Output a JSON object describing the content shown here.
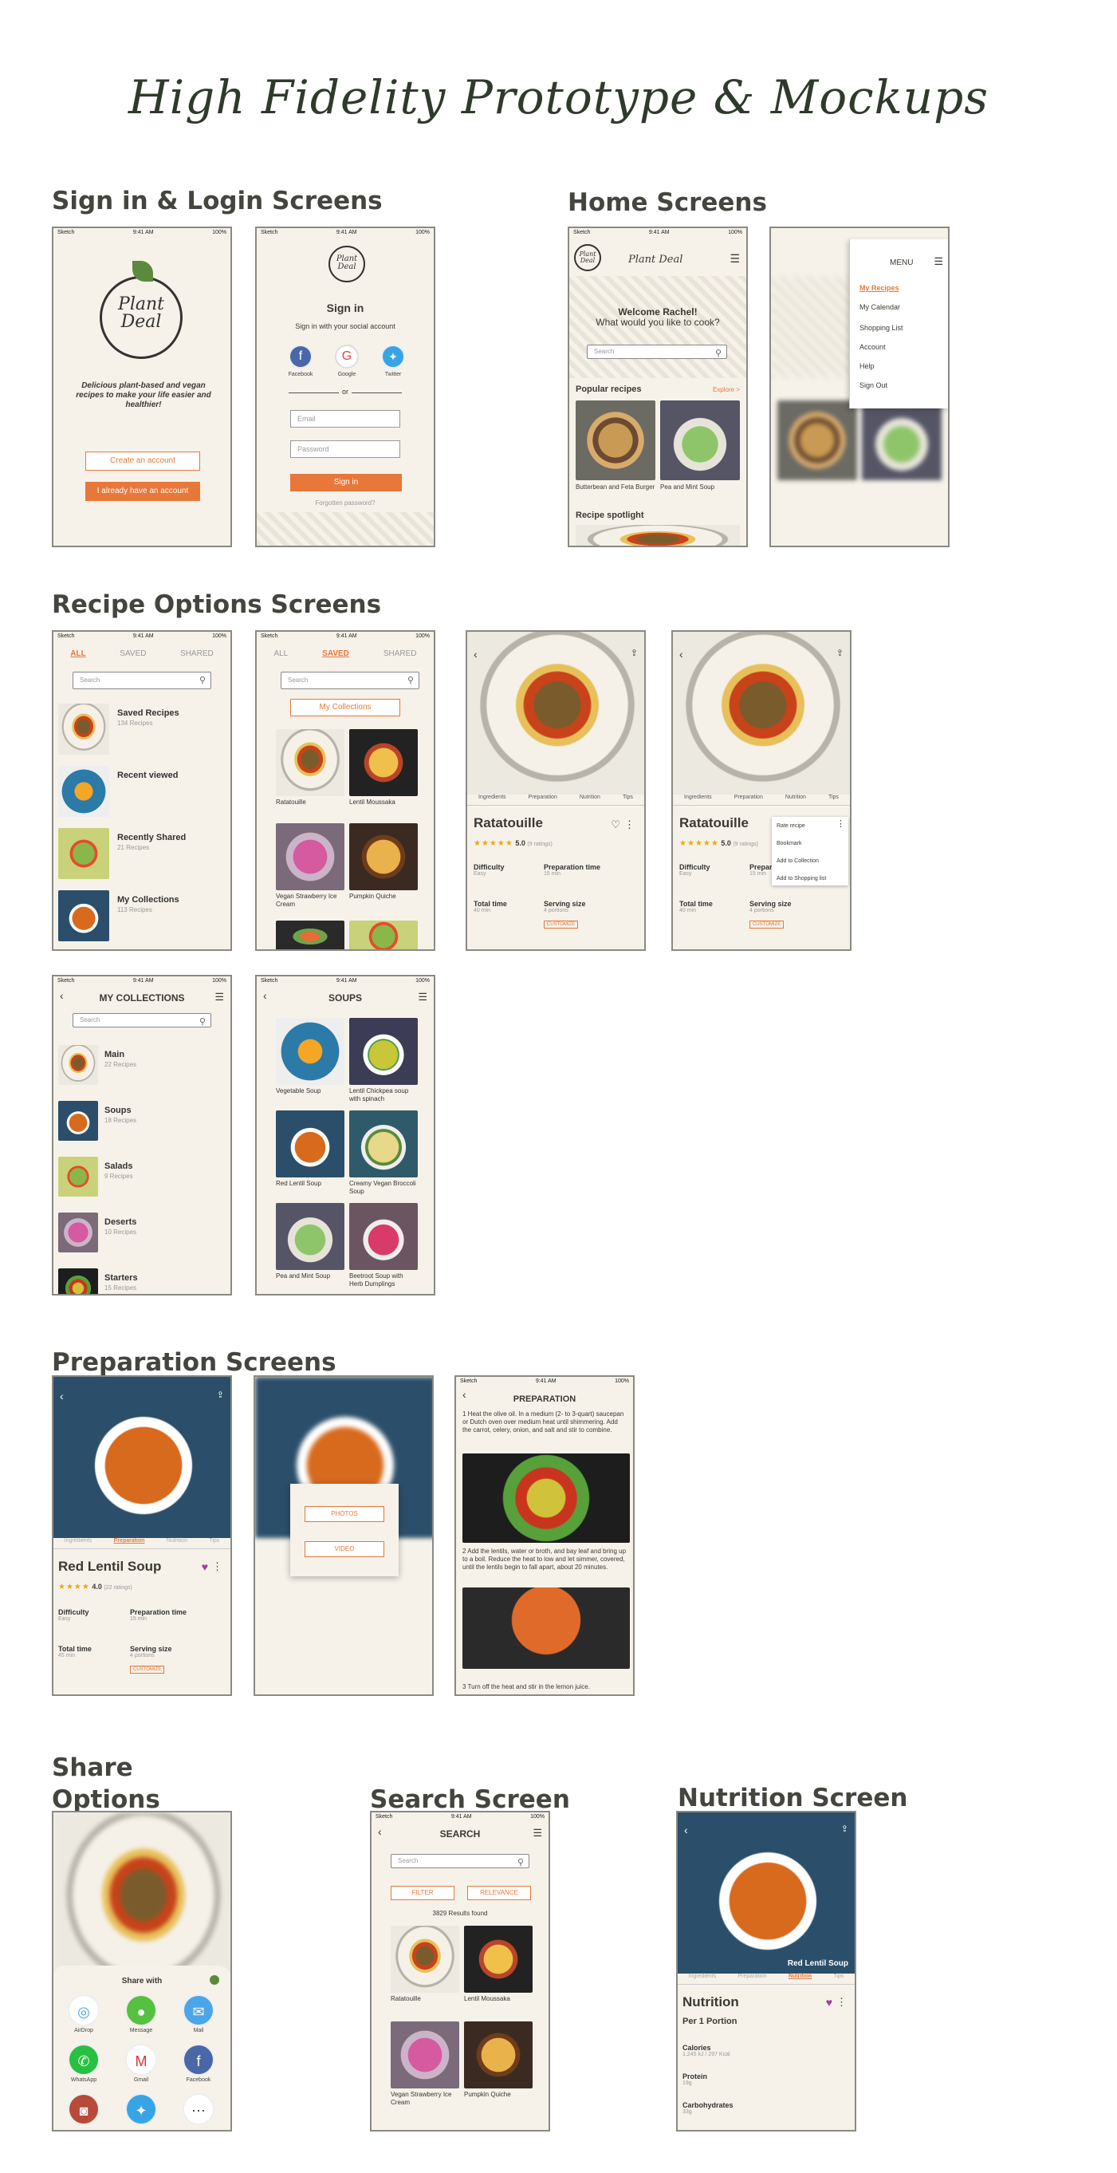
{
  "page_title": "High Fidelity Prototype & Mockups",
  "sections": {
    "signin": "Sign in & Login Screens",
    "home": "Home Screens",
    "recipe": "Recipe Options Screens",
    "prep": "Preparation Screens",
    "share": "Share Options Screen",
    "search": "Search Screen",
    "nutrition": "Nutrition Screen"
  },
  "status": {
    "carrier": "Sketch",
    "time": "9:41 AM",
    "battery": "100%"
  },
  "splash": {
    "logo_line1": "Plant",
    "logo_line2": "Deal",
    "tagline": "Delicious plant-based and vegan recipes to make your life easier and healthier!",
    "create": "Create an account",
    "have": "I already have an account"
  },
  "signin": {
    "title": "Sign in",
    "subtitle": "Sign in with your social account",
    "facebook": "Facebook",
    "google": "Google",
    "twitter": "Twitter",
    "or": "or",
    "email": "Email",
    "password": "Password",
    "button": "Sign in",
    "forgot": "Forgotten password?"
  },
  "home": {
    "brand": "Plant Deal",
    "welcome": "Welcome Rachel!",
    "question": "What would you like to cook?",
    "search": "Search",
    "popular": "Popular recipes",
    "explore": "Explore >",
    "r1": "Butterbean and Feta Burger",
    "r2": "Pea and Mint Soup",
    "spotlight": "Recipe spotlight"
  },
  "menu": {
    "label": "MENU",
    "items": [
      "My Recipes",
      "My Calendar",
      "Shopping List",
      "Account",
      "Help",
      "Sign Out"
    ]
  },
  "tabs": {
    "all": "ALL",
    "saved": "SAVED",
    "shared": "SHARED"
  },
  "search": "Search",
  "recipes_all": [
    {
      "t": "Saved Recipes",
      "s": "134 Recipes"
    },
    {
      "t": "Recent viewed",
      "s": ""
    },
    {
      "t": "Recently Shared",
      "s": "21 Recipes"
    },
    {
      "t": "My Collections",
      "s": "113 Recipes"
    }
  ],
  "saved": {
    "collections_btn": "My Collections",
    "items": [
      "Ratatouille",
      "Lentil Moussaka",
      "Vegan Strawberry Ice Cream",
      "Pumpkin Quiche"
    ]
  },
  "recipe": {
    "tabs": [
      "Ingredients",
      "Preparation",
      "Nutrition",
      "Tips"
    ],
    "name": "Ratatouille",
    "rating": "5.0",
    "ratings_count": "(9 ratings)",
    "difficulty": "Difficulty",
    "difficulty_v": "Easy",
    "prep": "Preparation time",
    "prep_v": "15 min",
    "total": "Total time",
    "total_v": "40 min",
    "serving": "Serving size",
    "serving_v": "4 portions",
    "customize": "CUSTOMIZE"
  },
  "recipe_menu": [
    "Rate recipe",
    "Bookmark",
    "Add to Collection",
    "Add to Shopping list"
  ],
  "collections": {
    "title": "MY COLLECTIONS",
    "items": [
      {
        "t": "Main",
        "s": "22 Recipes"
      },
      {
        "t": "Soups",
        "s": "18 Recipes"
      },
      {
        "t": "Salads",
        "s": "9 Recipes"
      },
      {
        "t": "Deserts",
        "s": "10 Recipes"
      },
      {
        "t": "Starters",
        "s": "15 Recipes"
      }
    ]
  },
  "soups": {
    "title": "SOUPS",
    "items": [
      "Vegetable Soup",
      "Lentil Chickpea soup with spinach",
      "Red Lentil Soup",
      "Creamy Vegan Broccoli Soup",
      "Pea and Mint Soup",
      "Beetroot Soup with Herb Dumplings"
    ]
  },
  "lentil": {
    "name": "Red Lentil Soup",
    "rating": "4.0",
    "ratings_count": "(22 ratings)",
    "prep_v": "15 min",
    "total_v": "45 min",
    "serving_v": "4 portions"
  },
  "media": {
    "photos": "PHOTOS",
    "video": "VIDEO"
  },
  "preparation": {
    "title": "PREPARATION",
    "step1": "1 Heat the olive oil. In a medium (2- to 3-quart) saucepan or Dutch oven over medium heat until shimmering. Add the carrot, celery, onion, and salt and stir to combine.",
    "step2": "2 Add the lentils, water or broth, and bay leaf and bring up to a boil. Reduce the heat to low and let simmer, covered, until the lentils begin to fall apart, about 20 minutes.",
    "step3": "3 Turn off the heat and stir in the lemon juice."
  },
  "share": {
    "title": "Share with",
    "apps": [
      "AirDrop",
      "Message",
      "Mail",
      "WhatsApp",
      "Gmail",
      "Facebook"
    ]
  },
  "search_screen": {
    "title": "SEARCH",
    "filter": "FILTER",
    "relevance": "RELEVANCE",
    "results": "3829 Results found",
    "items": [
      "Ratatouille",
      "Lentil Moussaka",
      "Vegan Strawberry Ice Cream",
      "Pumpkin Quiche"
    ]
  },
  "nutrition": {
    "image_caption": "Red Lentil Soup",
    "title": "Nutrition",
    "portion": "Per 1 Portion",
    "cal": "Calories",
    "cal_v": "1,245 kJ / 297 Kcal",
    "protein": "Protein",
    "protein_v": "19g",
    "carb": "Carbohydrates",
    "carb_v": "33g"
  }
}
